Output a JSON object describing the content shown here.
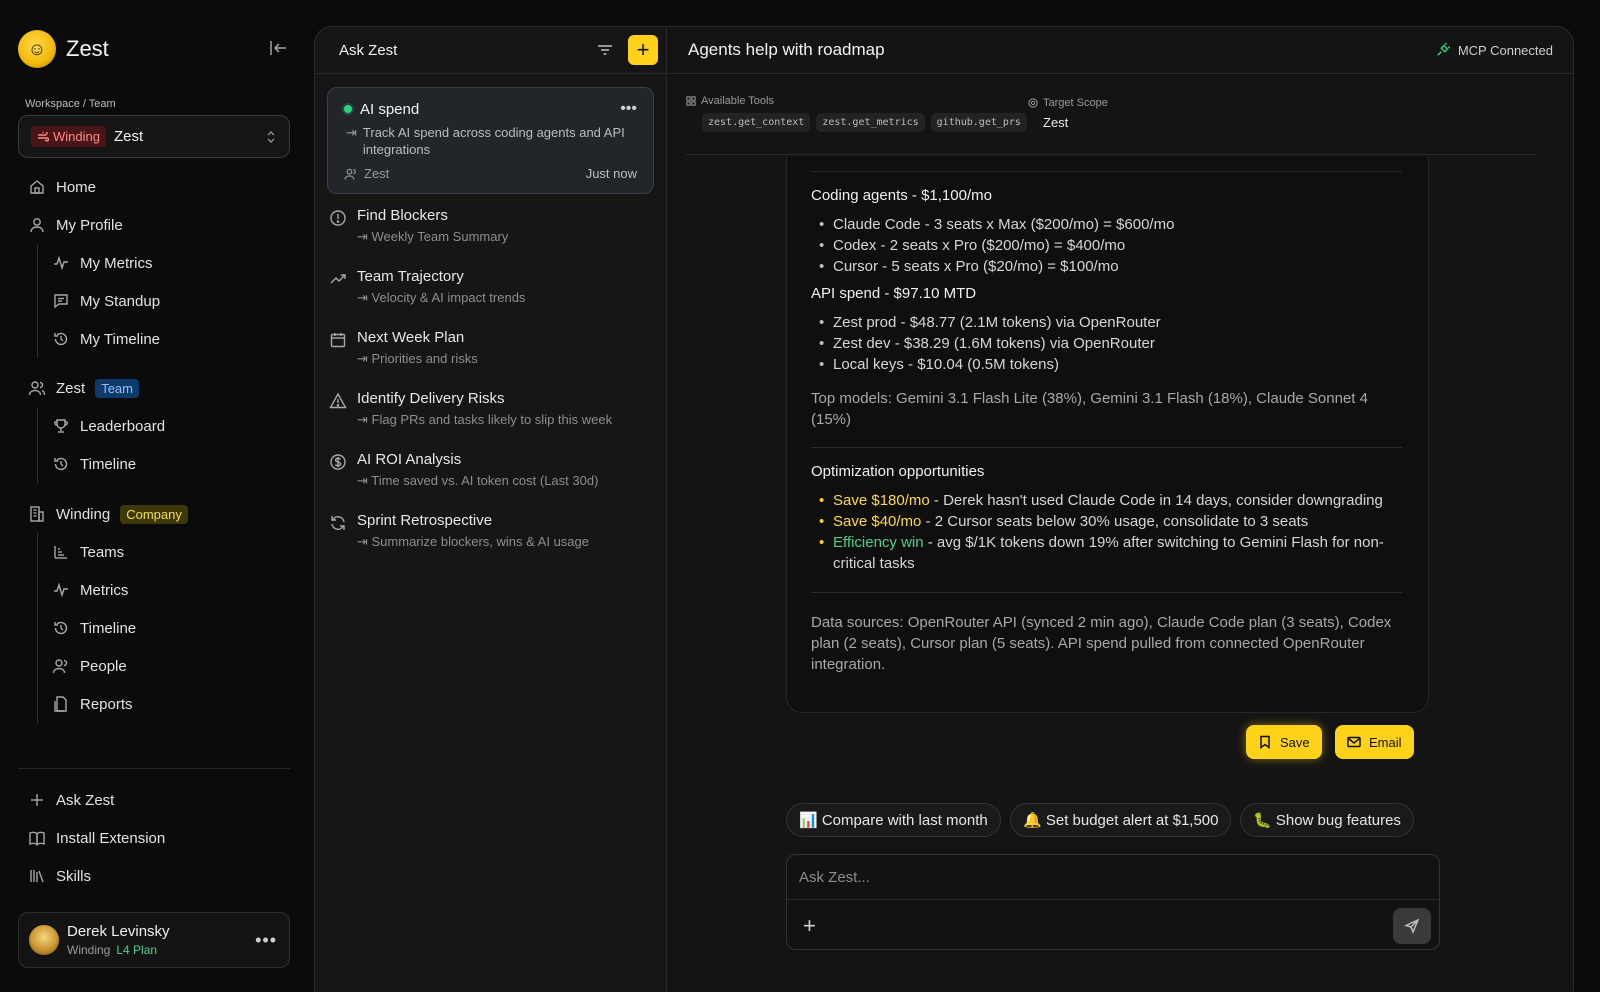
{
  "app": {
    "name": "Zest"
  },
  "workspace": {
    "label": "Workspace / Team",
    "org_tag": "Winding",
    "team": "Zest"
  },
  "nav": {
    "home": "Home",
    "my_profile": "My Profile",
    "my_metrics": "My Metrics",
    "my_standup": "My Standup",
    "my_timeline": "My Timeline",
    "team_name": "Zest",
    "team_badge": "Team",
    "leaderboard": "Leaderboard",
    "timeline": "Timeline",
    "company_name": "Winding",
    "company_badge": "Company",
    "teams": "Teams",
    "metrics": "Metrics",
    "company_timeline": "Timeline",
    "people": "People",
    "reports": "Reports",
    "ask_zest": "Ask Zest",
    "install_extension": "Install Extension",
    "skills": "Skills"
  },
  "user": {
    "name": "Derek Levinsky",
    "org": "Winding",
    "plan": "L4 Plan"
  },
  "threads": {
    "title": "Ask Zest",
    "active": {
      "title": "AI spend",
      "desc": "Track AI spend across coding agents and API integrations",
      "team": "Zest",
      "time": "Just now"
    },
    "items": [
      {
        "title": "Find Blockers",
        "sub": "Weekly Team Summary"
      },
      {
        "title": "Team Trajectory",
        "sub": "Velocity & AI impact trends"
      },
      {
        "title": "Next Week Plan",
        "sub": "Priorities and risks"
      },
      {
        "title": "Identify Delivery Risks",
        "sub": "Flag PRs and tasks likely to slip this week"
      },
      {
        "title": "AI ROI Analysis",
        "sub": "Time saved vs. AI token cost (Last 30d)"
      },
      {
        "title": "Sprint Retrospective",
        "sub": "Summarize blockers, wins & AI usage"
      }
    ]
  },
  "conversation": {
    "title": "Agents help with roadmap",
    "mcp_status": "MCP Connected",
    "tools_label": "Available Tools",
    "tools": [
      "zest.get_context",
      "zest.get_metrics",
      "github.get_prs"
    ],
    "scope_label": "Target Scope",
    "scope_value": "Zest",
    "message": {
      "coding_title": "Coding agents - $1,100/mo",
      "coding_items": [
        "Claude Code - 3 seats x Max ($200/mo) = $600/mo",
        "Codex - 2 seats x Pro ($200/mo) = $400/mo",
        "Cursor - 5 seats x Pro ($20/mo) = $100/mo"
      ],
      "api_title": "API spend - $97.10 MTD",
      "api_items": [
        "Zest prod - $48.77 (2.1M tokens) via OpenRouter",
        "Zest dev - $38.29 (1.6M tokens) via OpenRouter",
        "Local keys - $10.04 (0.5M tokens)"
      ],
      "top_models": "Top models: Gemini 3.1 Flash Lite (38%), Gemini 3.1 Flash (18%), Claude Sonnet 4 (15%)",
      "opt_title": "Optimization opportunities",
      "opt_items": [
        {
          "highlight": "Save $180/mo",
          "text": " - Derek hasn't used Claude Code in 14 days, consider downgrading"
        },
        {
          "highlight": "Save $40/mo",
          "text": " - 2 Cursor seats below 30% usage, consolidate to 3 seats"
        },
        {
          "highlight": "Efficiency win",
          "text": " - avg $/1K tokens down 19% after switching to Gemini Flash for non-critical tasks"
        }
      ],
      "sources": "Data sources: OpenRouter API (synced 2 min ago), Claude Code plan (3 seats), Codex plan (2 seats), Cursor plan (5 seats). API spend pulled from connected OpenRouter integration."
    },
    "save_label": "Save",
    "email_label": "Email",
    "suggestions": [
      "📊 Compare with last month",
      "🔔 Set budget alert at $1,500",
      "🐛 Show bug features"
    ],
    "composer_placeholder": "Ask Zest..."
  },
  "colors": {
    "accent": "#ffd21a",
    "success": "#2ed47a",
    "org_tag": "#ff8a8a"
  }
}
